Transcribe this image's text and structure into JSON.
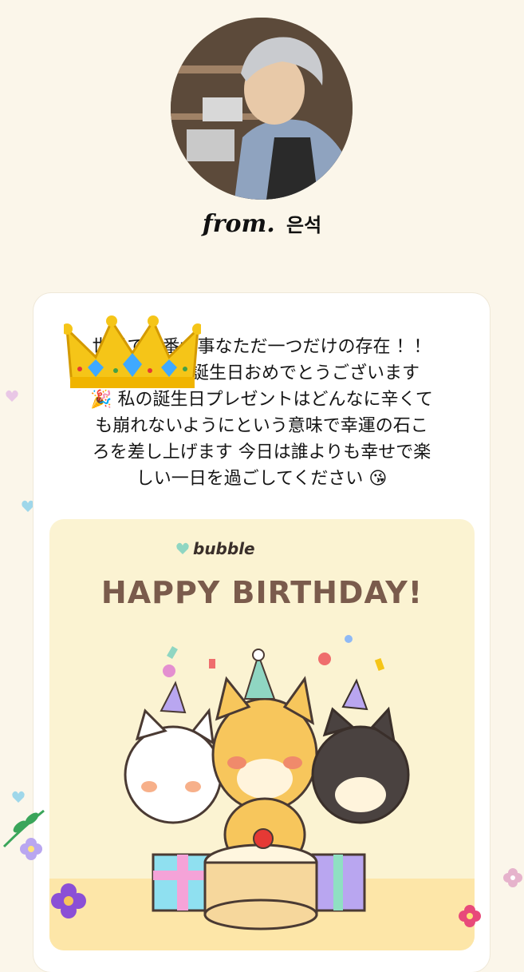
{
  "sender": {
    "from_label": "from.",
    "name": "은석"
  },
  "message": "世界で一番大事なただ一つだけの存在 ！！\nあなたへの誕生日おめでとうございます\n🎉 私の誕生日プレゼントはどんなに辛くて\nも崩れないようにという意味で幸運の石こ\nろを差し上げます 今日は誰よりも幸せで楽\nしい一日を過ごしてください 😘",
  "card": {
    "brand": "bubble",
    "headline": "HAPPY BIRTHDAY!"
  },
  "colors": {
    "background": "#fbf6ea",
    "headline": "#7a5b4c",
    "card_bg": "#fbf3d2",
    "accent": "#8fd6c2"
  },
  "icons": [
    "crown-icon",
    "heart-icon",
    "flower-icon",
    "leaf-icon",
    "dogs-illustration"
  ]
}
